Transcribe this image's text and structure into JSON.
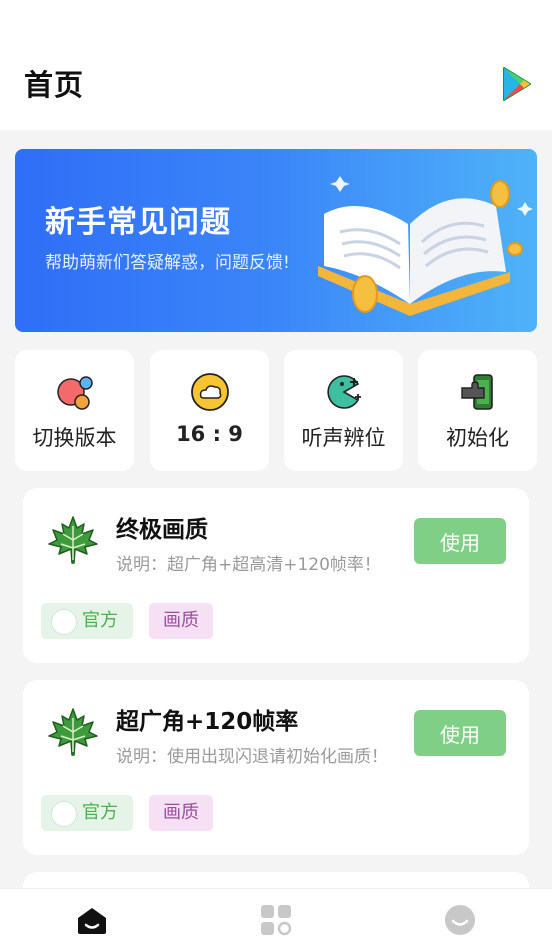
{
  "header": {
    "title": "首页"
  },
  "banner": {
    "title": "新手常见问题",
    "subtitle": "帮助萌新们答疑解惑，问题反馈!"
  },
  "quick_actions": [
    {
      "label": "切换版本",
      "icon": "bubbles-icon"
    },
    {
      "label": "16 : 9",
      "icon": "cloud-icon"
    },
    {
      "label": "听声辨位",
      "icon": "pacman-sound-icon"
    },
    {
      "label": "初始化",
      "icon": "phone-puzzle-icon"
    }
  ],
  "cards": [
    {
      "title": "终极画质",
      "description": "说明：超广角+超高清+120帧率！",
      "button": "使用",
      "tags": [
        "官方",
        "画质"
      ]
    },
    {
      "title": "超广角+120帧率",
      "description": "说明：使用出现闪退请初始化画质！",
      "button": "使用",
      "tags": [
        "官方",
        "画质"
      ]
    }
  ],
  "colors": {
    "accent_green": "#7fcf86",
    "banner_start": "#2f6ef7",
    "banner_end": "#4fb3f8",
    "tag_official_bg": "#e6f4e7",
    "tag_quality_bg": "#f5e1f3"
  },
  "tabbar": [
    {
      "icon": "home-icon"
    },
    {
      "icon": "apps-grid-icon"
    },
    {
      "icon": "smile-face-icon"
    }
  ]
}
